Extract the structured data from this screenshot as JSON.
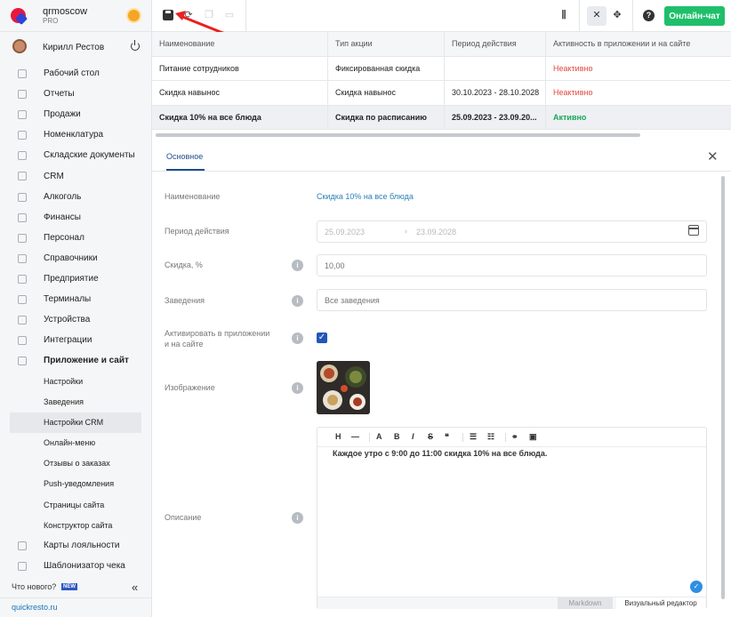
{
  "brand": {
    "name": "qrmoscow",
    "plan": "PRO"
  },
  "user": {
    "name": "Кирилл Рестов"
  },
  "nav": [
    {
      "label": "Рабочий стол"
    },
    {
      "label": "Отчеты"
    },
    {
      "label": "Продажи"
    },
    {
      "label": "Номенклатура"
    },
    {
      "label": "Складские документы"
    },
    {
      "label": "CRM"
    },
    {
      "label": "Алкоголь"
    },
    {
      "label": "Финансы"
    },
    {
      "label": "Персонал"
    },
    {
      "label": "Справочники"
    },
    {
      "label": "Предприятие"
    },
    {
      "label": "Терминалы"
    },
    {
      "label": "Устройства"
    },
    {
      "label": "Интеграции"
    },
    {
      "label": "Приложение и сайт"
    },
    {
      "label": "Настройки"
    },
    {
      "label": "Заведения"
    },
    {
      "label": "Настройки CRM"
    },
    {
      "label": "Онлайн-меню"
    },
    {
      "label": "Отзывы о заказах"
    },
    {
      "label": "Push-уведомления"
    },
    {
      "label": "Страницы сайта"
    },
    {
      "label": "Конструктор сайта"
    },
    {
      "label": "Карты лояльности"
    },
    {
      "label": "Шаблонизатор чека"
    }
  ],
  "sidebar_footer": {
    "whats_new": "Что нового?",
    "badge": "NEW",
    "link": "quickresto.ru"
  },
  "toolbar": {
    "online_chat": "Онлайн-чат"
  },
  "table": {
    "headers": [
      "Наименование",
      "Тип акции",
      "Период действия",
      "Активность в приложении и на сайте"
    ],
    "rows": [
      [
        "Питание сотрудников",
        "Фиксированная скидка",
        "",
        "Неактивно"
      ],
      [
        "Скидка навынос",
        "Скидка навынос",
        "30.10.2023 - 28.10.2028",
        "Неактивно"
      ],
      [
        "Скидка 10% на все блюда",
        "Скидка по расписанию",
        "25.09.2023 - 23.09.20...",
        "Активно"
      ]
    ]
  },
  "panel": {
    "tab": "Основное",
    "labels": {
      "name": "Наименование",
      "period": "Период действия",
      "discount": "Скидка, %",
      "venues": "Заведения",
      "activate": "Активировать в приложении и на сайте",
      "image": "Изображение",
      "description": "Описание"
    },
    "values": {
      "name": "Скидка 10% на все блюда",
      "date_from": "25.09.2023",
      "date_to": "23.09.2028",
      "discount": "10,00",
      "venues_placeholder": "Все заведения",
      "description": "Каждое утро с 9:00 до 11:00 скидка 10% на все блюда."
    },
    "editor_tabs": [
      "Markdown",
      "Визуальный редактор"
    ]
  }
}
